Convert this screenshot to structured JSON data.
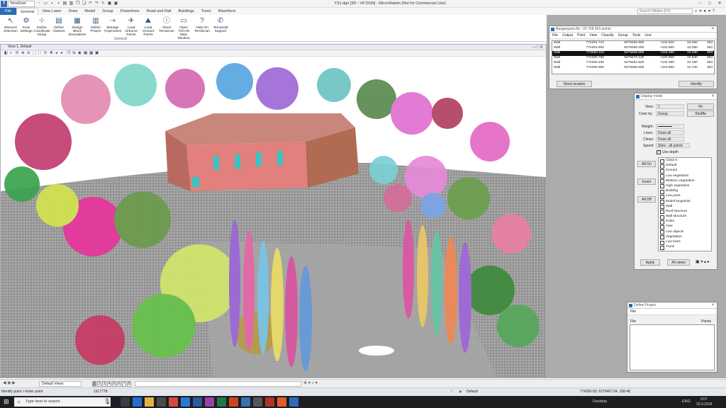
{
  "titlebar": {
    "app_logo": "T",
    "app_combo": "TerraScan",
    "window_title": "YS1.dgn [3D - V8 DGN] - MicroStation (Not for Commercial Use)"
  },
  "ribbon_tabs": [
    "File",
    "General",
    "View Laser",
    "Draw",
    "Model",
    "Group",
    "Powerlines",
    "Road and Rail",
    "Buildings",
    "Trees",
    "Waveform"
  ],
  "ribbon_search_placeholder": "Search Ribbon (F4)",
  "ribbon_buttons": [
    {
      "label": "Element Selection",
      "icon": "cursor-icon"
    },
    {
      "label": "Scan Settings",
      "icon": "scan-settings-icon"
    },
    {
      "label": "Define Coordinate Setup",
      "icon": "coordinate-icon"
    },
    {
      "label": "Define Classes",
      "icon": "classes-icon"
    },
    {
      "label": "Design Block Boundaries",
      "icon": "block-icon"
    },
    {
      "label": "Define Project",
      "icon": "project-icon"
    },
    {
      "label": "Manage Trajectories",
      "icon": "trajectory-icon"
    },
    {
      "label": "Load Airborne Points",
      "icon": "airborne-icon"
    },
    {
      "label": "Load Ground Points",
      "icon": "ground-points-icon"
    },
    {
      "label": "About TerraScan",
      "icon": "about-icon"
    },
    {
      "label": "Open TSCAN Main Window",
      "icon": "main-window-icon"
    },
    {
      "label": "Help On TerraScan",
      "icon": "help-icon"
    },
    {
      "label": "Terrasolid Support",
      "icon": "support-icon"
    }
  ],
  "ribbon_group_label": "General",
  "view": {
    "title": "View 1, Default"
  },
  "points_window": {
    "title": "Baugergues.fbi - 25 708 563 points",
    "menu": [
      "File",
      "Output",
      "Point",
      "View",
      "Classify",
      "Group",
      "Tools",
      "Line"
    ],
    "rows": [
      [
        "Wall",
        "774291.710",
        "6279466.900",
        "+102.620",
        "10.460",
        "363"
      ],
      [
        "Wall",
        "774291.900",
        "6279466.250",
        "+102.560",
        "10.390",
        "363"
      ],
      [
        "Wall",
        "774292.110",
        "6279465.580",
        "+102.460",
        "10.330",
        "363"
      ],
      [
        "Wall",
        "774290.780",
        "6279470.130",
        "+102.800",
        "10.840",
        "363"
      ],
      [
        "Wall",
        "774292.330",
        "6279464.920",
        "+102.360",
        "10.190",
        "363"
      ],
      [
        "Wall",
        "774290.980",
        "6279469.500",
        "+102.890",
        "10.740",
        "363"
      ]
    ],
    "selected_row": 2,
    "show_location": "Show location",
    "identify": "Identify"
  },
  "display_mode": {
    "title": "Display mode",
    "view_label": "View:",
    "view_value": "1",
    "fit": "Fit",
    "colorby_label": "Color by:",
    "colorby_value": "Group",
    "shuffle": "Shuffle",
    "weight_label": "Weight:",
    "lines_label": "Lines:",
    "lines_value": "Draw all",
    "clines_label": "Clines:",
    "clines_value": "Draw all",
    "speed_label": "Speed:",
    "speed_value": "Slow - all points",
    "depth": "Use depth",
    "all_on": "All On",
    "invert": "Invert",
    "all_off": "All Off",
    "classes": [
      "Class 0",
      "Default",
      "Ground",
      "Low vegetation",
      "Medium vegetation",
      "High vegetation",
      "Building",
      "Low point",
      "Model keypoints",
      "Wall",
      "Roof structure",
      "Wall structure",
      "Poles",
      "Tree",
      "Low objects",
      "Vegetation",
      "Low trees",
      "Trunk"
    ],
    "apply": "Apply",
    "all_views": "All views"
  },
  "define_project": {
    "title": "Define Project",
    "menu": "File",
    "col_file": "File",
    "col_points": "Points"
  },
  "view_bottom": {
    "views_combo": "Default Views",
    "view_numbers": [
      "1",
      "2",
      "3",
      "4",
      "5",
      "6",
      "7",
      "8"
    ]
  },
  "status": {
    "prompt": "Identify point > Enter point",
    "coord_hint": "1917778",
    "level": "Default",
    "coords": "774266.83, 6279467.64, 108.48"
  },
  "taskbar": {
    "search_placeholder": "Type here to search",
    "desktop": "Desktop",
    "lang": "ENG",
    "time": "9:07",
    "date": "20.9.2018"
  }
}
